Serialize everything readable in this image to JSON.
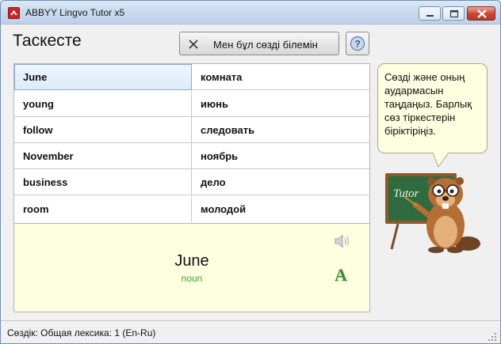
{
  "window": {
    "title": "ABBYY Lingvo Tutor x5"
  },
  "page": {
    "heading": "Таскесте"
  },
  "toolbar": {
    "know_label": "Мен бұл сөзді білемін"
  },
  "pairs": [
    {
      "left": "June",
      "right": "комната"
    },
    {
      "left": "young",
      "right": "июнь"
    },
    {
      "left": "follow",
      "right": "следовать"
    },
    {
      "left": "November",
      "right": "ноябрь"
    },
    {
      "left": "business",
      "right": "дело"
    },
    {
      "left": "room",
      "right": "молодой"
    }
  ],
  "selected_index": 0,
  "detail": {
    "word": "June",
    "part_of_speech": "noun",
    "font_glyph": "A"
  },
  "bubble": {
    "text": "Сөзді және оның аудармасын таңдаңыз. Барлық сөз тіркестерін біріктіріңіз."
  },
  "mascot": {
    "board_text": "Tutor"
  },
  "status": {
    "text": "Сөздік: Общая лексика: 1 (En-Ru)"
  },
  "colors": {
    "accent_green": "#3aa82e",
    "detail_bg": "#fefee0",
    "selected_border": "#84acdd",
    "close_red": "#c8452f"
  }
}
